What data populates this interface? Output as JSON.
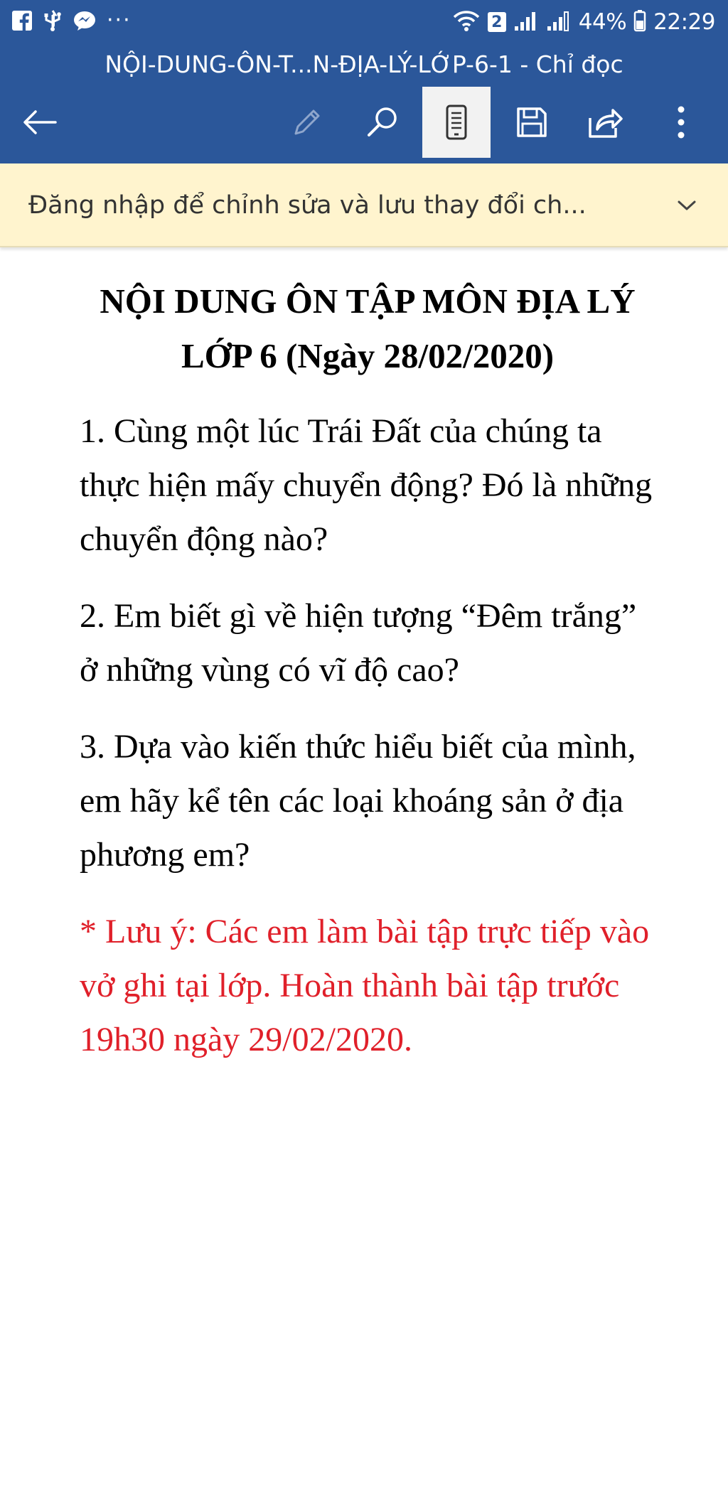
{
  "status_bar": {
    "battery_percent": "44%",
    "time": "22:29",
    "sim_badge": "2",
    "more_indicator": "···",
    "notification_icons": [
      "facebook-icon",
      "usb-icon",
      "messenger-icon"
    ]
  },
  "header": {
    "title": "NỘI-DUNG-ÔN-T...N-ĐỊA-LÝ-LỚP-6-1 - Chỉ đọc",
    "background_color": "#2b579a",
    "toolbar_icons": [
      "back-arrow-icon",
      "pencil-icon",
      "search-icon",
      "mobile-view-icon",
      "save-icon",
      "share-icon",
      "more-options-icon"
    ]
  },
  "banner": {
    "text": "Đăng nhập để chỉnh sửa và lưu thay đổi ch...",
    "background_color": "#fff4ce"
  },
  "document": {
    "title": "NỘI DUNG ÔN TẬP MÔN ĐỊA LÝ LỚP 6 (Ngày 28/02/2020)",
    "questions": [
      "1. Cùng một lúc Trái Đất của chúng ta thực hiện mấy chuyển động? Đó là những chuyển động nào?",
      "2. Em biết gì về hiện tượng “Đêm trắng” ở những vùng có vĩ độ cao?",
      "3. Dựa vào kiến thức hiểu biết của mình, em hãy kể tên các loại khoáng sản ở địa phương em?"
    ],
    "note": "* Lưu ý: Các em làm bài tập trực tiếp vào vở ghi tại lớp. Hoàn thành bài tập trước 19h30 ngày 29/02/2020.",
    "note_color": "#e0202a"
  }
}
